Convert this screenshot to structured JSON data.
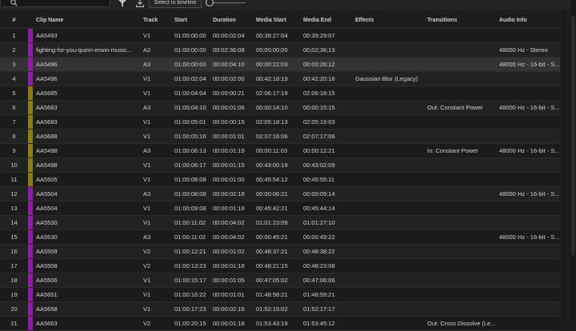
{
  "toolbar": {
    "search_placeholder": "",
    "select_in_timeline_label": "Select in timeline",
    "icons": [
      "search-icon",
      "filter-icon",
      "export-icon"
    ]
  },
  "columns": [
    "#",
    "Clip Name",
    "Track",
    "Start",
    "Duration",
    "Media Start",
    "Media End",
    "Effects",
    "Transitions",
    "Audio Info"
  ],
  "label_colors": {
    "purple": "#8a1fa6",
    "olive": "#8a7d16"
  },
  "rows": [
    {
      "num": "1",
      "label": "purple",
      "clip": "AA5493",
      "track": "V1",
      "start": "01:00:00:00",
      "duration": "00:00:02:04",
      "media_start": "00:39:27:04",
      "media_end": "00:39:29:07",
      "effects": "",
      "transitions": "",
      "audio": ""
    },
    {
      "num": "2",
      "label": "purple",
      "clip": "fighting-for-you-quinn-erwin-music...",
      "track": "A2",
      "start": "01:00:00:00",
      "duration": "00:02:36:08",
      "media_start": "00;00;00;00",
      "media_end": "00;02;36;13",
      "effects": "",
      "transitions": "",
      "audio": "48000 Hz - Stereo"
    },
    {
      "num": "3",
      "label": "purple",
      "clip": "AA5496",
      "track": "A3",
      "start": "01:00:00:00",
      "duration": "00:00:04:10",
      "media_start": "00:00:22:03",
      "media_end": "00:00:26:12",
      "effects": "",
      "transitions": "",
      "audio": "48000 Hz - 16-bit - S...",
      "selected": true
    },
    {
      "num": "4",
      "label": "purple",
      "clip": "AA5496",
      "track": "V1",
      "start": "01:00:02:04",
      "duration": "00:00:02:00",
      "media_start": "00:42:18:19",
      "media_end": "00:42:20:18",
      "effects": "Gaussian Blur (Legacy)",
      "transitions": "",
      "audio": ""
    },
    {
      "num": "5",
      "label": "olive",
      "clip": "AA5685",
      "track": "V1",
      "start": "01:00:04:04",
      "duration": "00:00:00:21",
      "media_start": "02:06:17:19",
      "media_end": "02:06:18:15",
      "effects": "",
      "transitions": "",
      "audio": ""
    },
    {
      "num": "6",
      "label": "olive",
      "clip": "AA5683",
      "track": "A3",
      "start": "01:00:04:10",
      "duration": "00:00:01:06",
      "media_start": "00:00:14:10",
      "media_end": "00:00:15:15",
      "effects": "",
      "transitions": "Out: Constant Power",
      "audio": "48000 Hz - 16-bit - S..."
    },
    {
      "num": "7",
      "label": "olive",
      "clip": "AA5683",
      "track": "V1",
      "start": "01:00:05:01",
      "duration": "00:00:00:15",
      "media_start": "02:05:18:13",
      "media_end": "02:05:19:03",
      "effects": "",
      "transitions": "",
      "audio": ""
    },
    {
      "num": "8",
      "label": "olive",
      "clip": "AA5688",
      "track": "V1",
      "start": "01:00:05:16",
      "duration": "00:00:01:01",
      "media_start": "02:07:16:06",
      "media_end": "02:07:17:06",
      "effects": "",
      "transitions": "",
      "audio": ""
    },
    {
      "num": "9",
      "label": "olive",
      "clip": "AA5498",
      "track": "A3",
      "start": "01:00:06:13",
      "duration": "00:00:01:19",
      "media_start": "00:00:11:03",
      "media_end": "00:00:12:21",
      "effects": "",
      "transitions": "In: Constant Power",
      "audio": "48000 Hz - 16-bit - S..."
    },
    {
      "num": "10",
      "label": "olive",
      "clip": "AA5498",
      "track": "V1",
      "start": "01:00:06:17",
      "duration": "00:00:01:15",
      "media_start": "00:43:00:19",
      "media_end": "00:43:02:09",
      "effects": "",
      "transitions": "",
      "audio": ""
    },
    {
      "num": "11",
      "label": "olive",
      "clip": "AA5505",
      "track": "V1",
      "start": "01:00:08:08",
      "duration": "00:00:01:00",
      "media_start": "00:45:54:12",
      "media_end": "00:45:55:11",
      "effects": "",
      "transitions": "",
      "audio": ""
    },
    {
      "num": "12",
      "label": "purple",
      "clip": "AA5504",
      "track": "A3",
      "start": "01:00:08:08",
      "duration": "00:00:02:18",
      "media_start": "00:00:06:21",
      "media_end": "00:00:09:14",
      "effects": "",
      "transitions": "",
      "audio": "48000 Hz - 16-bit - S..."
    },
    {
      "num": "13",
      "label": "purple",
      "clip": "AA5504",
      "track": "V1",
      "start": "01:00:09:08",
      "duration": "00:00:01:18",
      "media_start": "00:45:42:21",
      "media_end": "00:45:44:14",
      "effects": "",
      "transitions": "",
      "audio": ""
    },
    {
      "num": "14",
      "label": "purple",
      "clip": "AA5530",
      "track": "V1",
      "start": "01:00:11:02",
      "duration": "00:00:04:02",
      "media_start": "01:01:23:09",
      "media_end": "01:01:27:10",
      "effects": "",
      "transitions": "",
      "audio": ""
    },
    {
      "num": "15",
      "label": "purple",
      "clip": "AA5530",
      "track": "A3",
      "start": "01:00:11:02",
      "duration": "00:00:04:02",
      "media_start": "00:00:45:21",
      "media_end": "00:00:49:22",
      "effects": "",
      "transitions": "",
      "audio": "48000 Hz - 16-bit - S..."
    },
    {
      "num": "16",
      "label": "purple",
      "clip": "AA5509",
      "track": "V2",
      "start": "01:00:12:21",
      "duration": "00:00:01:02",
      "media_start": "00:48:37:21",
      "media_end": "00:48:38:22",
      "effects": "",
      "transitions": "",
      "audio": ""
    },
    {
      "num": "17",
      "label": "purple",
      "clip": "AA5508",
      "track": "V2",
      "start": "01:00:13:23",
      "duration": "00:00:01:18",
      "media_start": "00:48:21:15",
      "media_end": "00:48:23:08",
      "effects": "",
      "transitions": "",
      "audio": ""
    },
    {
      "num": "18",
      "label": "purple",
      "clip": "AA5506",
      "track": "V1",
      "start": "01:00:15:17",
      "duration": "00:00:01:05",
      "media_start": "00:47:05:02",
      "media_end": "00:47:06:06",
      "effects": "",
      "transitions": "",
      "audio": ""
    },
    {
      "num": "19",
      "label": "purple",
      "clip": "AA5651",
      "track": "V1",
      "start": "01:00:16:22",
      "duration": "00:00:01:01",
      "media_start": "01:48:58:21",
      "media_end": "01:48:59:21",
      "effects": "",
      "transitions": "",
      "audio": ""
    },
    {
      "num": "20",
      "label": "purple",
      "clip": "AA5658",
      "track": "V1",
      "start": "01:00:17:23",
      "duration": "00:00:02:16",
      "media_start": "01:52:15:02",
      "media_end": "01:52:17:17",
      "effects": "",
      "transitions": "",
      "audio": ""
    },
    {
      "num": "21",
      "label": "purple",
      "clip": "AA5663",
      "track": "V2",
      "start": "01:00:20:15",
      "duration": "00:00:01:18",
      "media_start": "01:53:43:19",
      "media_end": "01:53:45:12",
      "effects": "",
      "transitions": "Out: Cross Dissolve (Le...",
      "audio": ""
    }
  ]
}
